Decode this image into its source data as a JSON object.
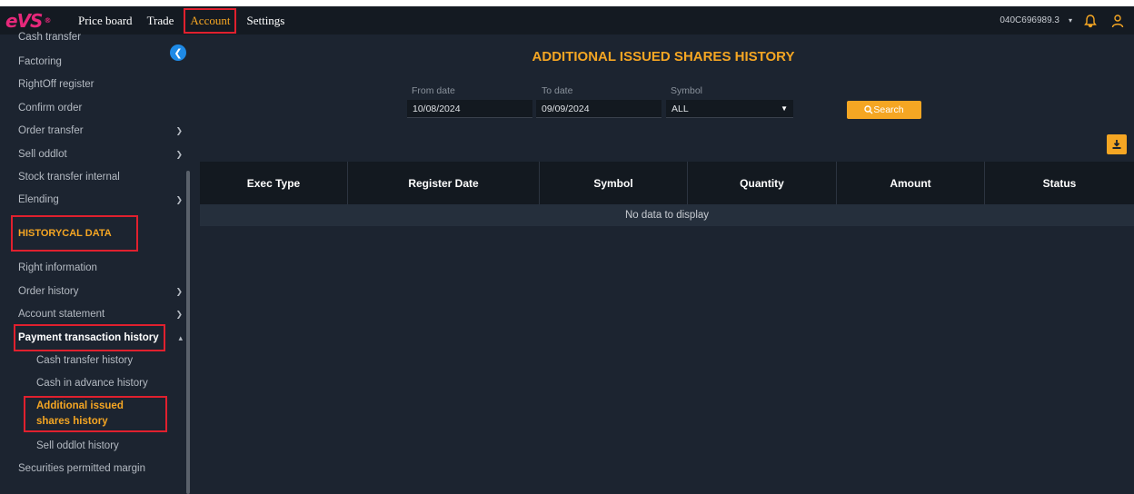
{
  "nav": {
    "logo": "eVS",
    "items": [
      "Price board",
      "Trade",
      "Account",
      "Settings"
    ],
    "account_number": "040C696989.3"
  },
  "sidebar": {
    "items_top": [
      {
        "label": "Cash transfer",
        "chevron": false
      },
      {
        "label": "Factoring",
        "chevron": false
      },
      {
        "label": "RightOff register",
        "chevron": false
      },
      {
        "label": "Confirm order",
        "chevron": false
      },
      {
        "label": "Order transfer",
        "chevron": true
      },
      {
        "label": "Sell oddlot",
        "chevron": true
      },
      {
        "label": "Stock transfer internal",
        "chevron": false
      },
      {
        "label": "Elending",
        "chevron": true
      }
    ],
    "section_title": "HISTORYCAL DATA",
    "items_hist": [
      {
        "label": "Right information",
        "chevron": false
      },
      {
        "label": "Order history",
        "chevron": true
      },
      {
        "label": "Account statement",
        "chevron": true
      }
    ],
    "payment_group": "Payment transaction history",
    "sub_items": [
      "Cash transfer history",
      "Cash in advance history"
    ],
    "active_item": "Additional issued shares history",
    "after_items": [
      {
        "label": "Sell oddlot history",
        "sub": true
      },
      {
        "label": "Securities permitted margin",
        "sub": false
      }
    ]
  },
  "main": {
    "title": "ADDITIONAL ISSUED SHARES HISTORY",
    "filters": {
      "from_label": "From date",
      "from_value": "10/08/2024",
      "to_label": "To date",
      "to_value": "09/09/2024",
      "symbol_label": "Symbol",
      "symbol_value": "ALL",
      "search_label": "Search"
    },
    "table": {
      "columns": [
        "Exec Type",
        "Register Date",
        "Symbol",
        "Quantity",
        "Amount",
        "Status"
      ],
      "empty_text": "No data to display"
    }
  },
  "colors": {
    "accent": "#f5a623",
    "highlight_box": "#e0202e",
    "background": "#1c2430",
    "brand": "#e6287a"
  }
}
